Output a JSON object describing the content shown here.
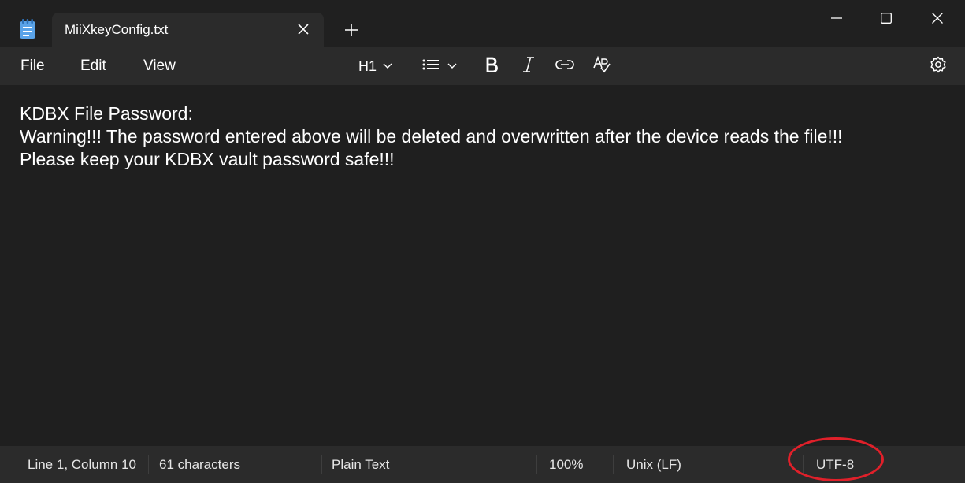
{
  "window": {
    "tab_title": "MiiXkeyConfig.txt",
    "icons": {
      "app": "notepad-icon",
      "tab_close": "close-icon",
      "new_tab": "plus-icon",
      "minimize": "minimize-icon",
      "maximize": "maximize-icon",
      "close": "close-icon"
    }
  },
  "menu": {
    "file": "File",
    "edit": "Edit",
    "view": "View"
  },
  "toolbar": {
    "heading_label": "H1",
    "icons": [
      "chevron-down-icon",
      "list-icon",
      "bold-icon",
      "italic-icon",
      "link-icon",
      "spellcheck-icon",
      "settings-icon"
    ]
  },
  "document": {
    "lines": [
      "KDBX File Password:",
      "Warning!!! The password entered above will be deleted and overwritten after the device reads the file!!!",
      "Please keep your KDBX vault password safe!!!"
    ]
  },
  "status": {
    "position": "Line 1, Column 10",
    "characters": "61 characters",
    "format": "Plain Text",
    "zoom": "100%",
    "line_ending": "Unix (LF)",
    "encoding": "UTF-8"
  },
  "colors": {
    "titlebar": "#202020",
    "menubar": "#2b2b2b",
    "editor_bg": "#1f1f1f",
    "text": "#ffffff",
    "annotation_ring": "#e0202a"
  }
}
